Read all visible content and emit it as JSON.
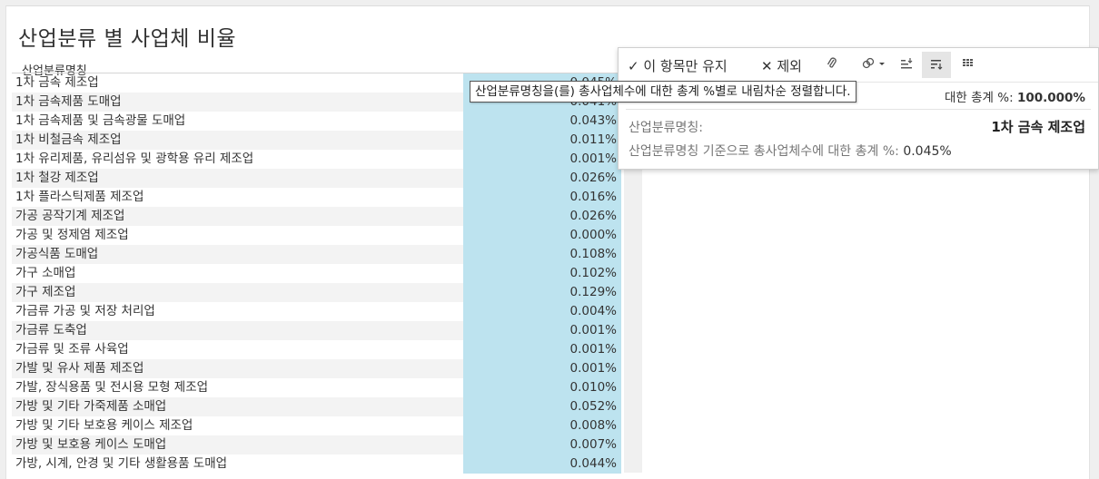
{
  "sheet": {
    "title": "산업분류 별 사업체 비율",
    "column_header": "산업분류명칭"
  },
  "rows": [
    {
      "label": "1차 금속 제조업",
      "value": "0.045%"
    },
    {
      "label": "1차 금속제품 도매업",
      "value": "0.041%"
    },
    {
      "label": "1차 금속제품 및 금속광물 도매업",
      "value": "0.043%"
    },
    {
      "label": "1차 비철금속 제조업",
      "value": "0.011%"
    },
    {
      "label": "1차 유리제품, 유리섬유 및 광학용 유리 제조업",
      "value": "0.001%"
    },
    {
      "label": "1차 철강 제조업",
      "value": "0.026%"
    },
    {
      "label": "1차 플라스틱제품 제조업",
      "value": "0.016%"
    },
    {
      "label": "가공 공작기계 제조업",
      "value": "0.026%"
    },
    {
      "label": "가공 및 정제염 제조업",
      "value": "0.000%"
    },
    {
      "label": "가공식품 도매업",
      "value": "0.108%"
    },
    {
      "label": "가구 소매업",
      "value": "0.102%"
    },
    {
      "label": "가구 제조업",
      "value": "0.129%"
    },
    {
      "label": "가금류 가공 및 저장 처리업",
      "value": "0.004%"
    },
    {
      "label": "가금류 도축업",
      "value": "0.001%"
    },
    {
      "label": "가금류 및 조류 사육업",
      "value": "0.001%"
    },
    {
      "label": "가발 및 유사 제품 제조업",
      "value": "0.001%"
    },
    {
      "label": "가발, 장식용품 및 전시용 모형 제조업",
      "value": "0.010%"
    },
    {
      "label": "가방 및 기타 가죽제품 소매업",
      "value": "0.052%"
    },
    {
      "label": "가방 및 기타 보호용 케이스 제조업",
      "value": "0.008%"
    },
    {
      "label": "가방 및 보호용 케이스 도매업",
      "value": "0.007%"
    },
    {
      "label": "가방, 시계, 안경 및 기타 생활용품 도매업",
      "value": "0.044%"
    }
  ],
  "tooltip": {
    "keep_only": "✓ 이 항목만 유지",
    "exclude": "✕ 제외",
    "icons": [
      "attach-icon",
      "link-dropdown-icon",
      "sort-ascending-icon",
      "sort-descending-icon",
      "view-data-icon"
    ],
    "summary_label_partial": "대한 총계 %:",
    "summary_value": "100.000%",
    "field1_label": "산업분류명칭:",
    "field1_value": "1차 금속 제조업",
    "field2_label": "산업분류명칭 기준으로 총사업체수에 대한 총계 %:",
    "field2_value": "0.045%"
  },
  "hover_hint": "산업분류명칭을(를) 총사업체수에 대한 총계 %별로 내림차순 정렬합니다.",
  "colors": {
    "bar": "#bde3ef",
    "alt_row": "#f3f3f3"
  }
}
